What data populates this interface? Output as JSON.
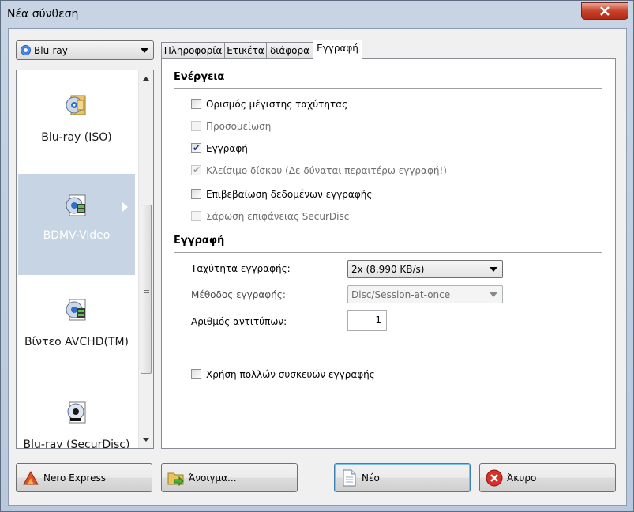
{
  "window": {
    "title": "Νέα σύνθεση"
  },
  "disc_type": {
    "selected": "Blu-ray"
  },
  "compilations": [
    {
      "label": "Blu-ray (ISO)",
      "icon": "blu-ray-iso-icon",
      "selected": false
    },
    {
      "label": "BDMV-Video",
      "icon": "bdmv-video-icon",
      "selected": true
    },
    {
      "label": "Βίντεο AVCHD(TM)",
      "icon": "avchd-video-icon",
      "selected": false
    },
    {
      "label": "Blu-ray (SecurDisc)",
      "icon": "securdisc-icon",
      "selected": false
    }
  ],
  "tabs": [
    {
      "label": "Πληροφορία",
      "active": false
    },
    {
      "label": "Ετικέτα",
      "active": false
    },
    {
      "label": "διάφορα",
      "active": false
    },
    {
      "label": "Εγγραφή",
      "active": true
    }
  ],
  "actions_section": {
    "title": "Ενέργεια",
    "options": [
      {
        "label": "Ορισμός μέγιστης ταχύτητας",
        "checked": false,
        "enabled": true
      },
      {
        "label": "Προσομείωση",
        "checked": false,
        "enabled": false
      },
      {
        "label": "Εγγραφή",
        "checked": true,
        "enabled": true
      },
      {
        "label": "Κλείσιμο δίσκου (Δε δύναται περαιτέρω εγγραφή!)",
        "checked": true,
        "enabled": false
      },
      {
        "label": "Επιβεβαίωση δεδομένων εγγραφής",
        "checked": false,
        "enabled": true
      },
      {
        "label": "Σάρωση επιφάνειας SecurDisc",
        "checked": false,
        "enabled": false
      }
    ]
  },
  "write_section": {
    "title": "Εγγραφή",
    "speed_label": "Ταχύτητα εγγραφής:",
    "speed_value": "2x (8,990 KB/s)",
    "method_label": "Μέθοδος εγγραφής:",
    "method_value": "Disc/Session-at-once",
    "copies_label": "Αριθμός αντιτύπων:",
    "copies_value": "1",
    "multi_device_label": "Χρήση πολλών συσκευών εγγραφής",
    "multi_device_checked": false
  },
  "buttons": {
    "nero_express": "Nero Express",
    "open": "Άνοιγμα...",
    "new": "Νέο",
    "cancel": "Άκυρο"
  }
}
